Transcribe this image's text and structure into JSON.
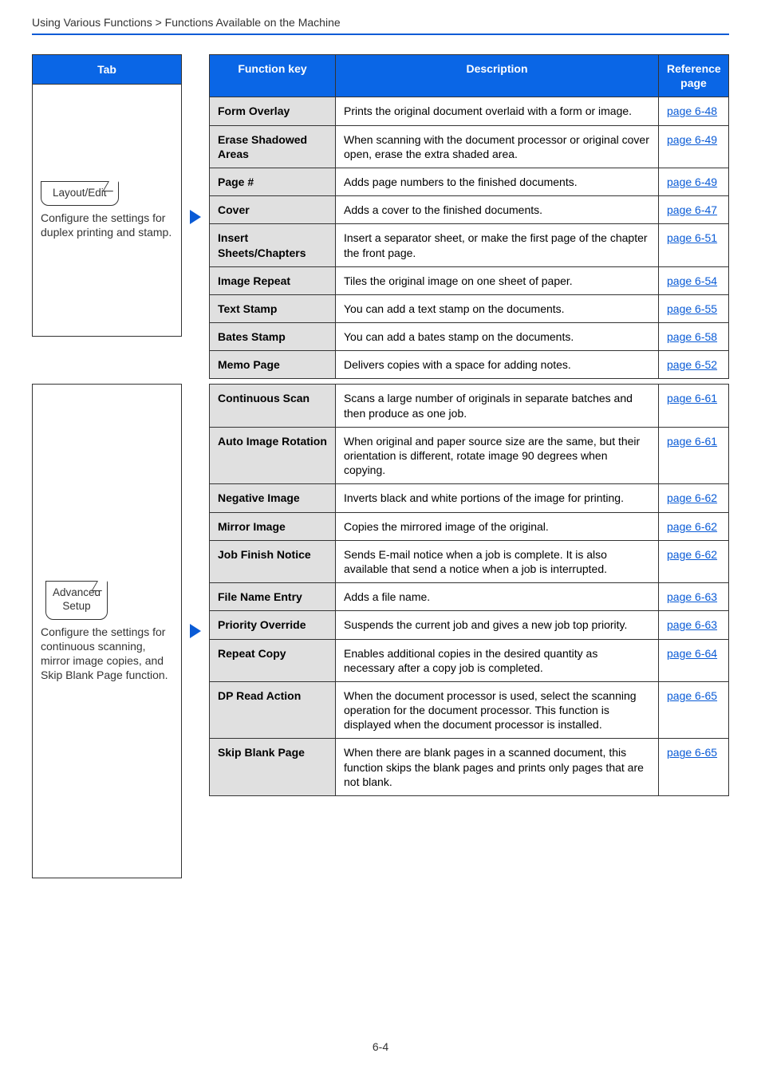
{
  "breadcrumb": "Using Various Functions > Functions Available on the Machine",
  "tab_header": "Tab",
  "headers": {
    "fn": "Function key",
    "desc": "Description",
    "ref": "Reference page"
  },
  "box1": {
    "chip": "Layout/Edit",
    "desc": "Configure the settings for duplex printing and stamp.",
    "rows": [
      {
        "fn": "Form Overlay",
        "desc": "Prints the original document overlaid with a form or image.",
        "ref": "page 6-48"
      },
      {
        "fn": "Erase Shadowed Areas",
        "desc": "When scanning with the document processor or original cover open, erase the extra shaded area.",
        "ref": "page 6-49"
      },
      {
        "fn": "Page #",
        "desc": "Adds page numbers to the finished documents.",
        "ref": "page 6-49"
      },
      {
        "fn": "Cover",
        "desc": "Adds a cover to the finished documents.",
        "ref": "page 6-47"
      },
      {
        "fn": "Insert Sheets/Chapters",
        "desc": "Insert a separator sheet, or make the first page of the chapter the front page.",
        "ref": "page 6-51"
      },
      {
        "fn": "Image Repeat",
        "desc": "Tiles the original image on one sheet of paper.",
        "ref": "page 6-54"
      },
      {
        "fn": "Text Stamp",
        "desc": "You can add a text stamp on the documents.",
        "ref": "page 6-55"
      },
      {
        "fn": "Bates Stamp",
        "desc": "You can add a bates stamp on the documents.",
        "ref": "page 6-58"
      },
      {
        "fn": "Memo Page",
        "desc": "Delivers copies with a space for adding notes.",
        "ref": "page 6-52"
      }
    ]
  },
  "box2": {
    "chip_l1": "Advanced",
    "chip_l2": "Setup",
    "desc": "Configure the settings for continuous scanning, mirror image copies, and Skip Blank Page function.",
    "rows": [
      {
        "fn": "Continuous Scan",
        "desc": "Scans a large number of originals in separate batches and then produce as one job.",
        "ref": "page 6-61"
      },
      {
        "fn": "Auto Image Rotation",
        "desc": "When original and paper source size are the same, but their orientation is different, rotate image 90 degrees when copying.",
        "ref": "page 6-61"
      },
      {
        "fn": "Negative Image",
        "desc": "Inverts black and white portions of the image for printing.",
        "ref": "page 6-62"
      },
      {
        "fn": "Mirror Image",
        "desc": "Copies the mirrored image of the original.",
        "ref": "page 6-62"
      },
      {
        "fn": "Job Finish Notice",
        "desc": "Sends E-mail notice when a job is complete. It is also available that send a notice when a job is interrupted.",
        "ref": "page 6-62"
      },
      {
        "fn": "File Name Entry",
        "desc": "Adds a file name.",
        "ref": "page 6-63"
      },
      {
        "fn": "Priority Override",
        "desc": "Suspends the current job and gives a new job top priority.",
        "ref": "page 6-63"
      },
      {
        "fn": "Repeat Copy",
        "desc": "Enables additional copies in the desired quantity as necessary after a copy job is completed.",
        "ref": "page 6-64"
      },
      {
        "fn": "DP Read Action",
        "desc": "When the document processor is used, select the scanning operation for the document processor. This function is displayed when the document processor is installed.",
        "ref": "page 6-65"
      },
      {
        "fn": "Skip Blank Page",
        "desc": "When there are blank pages in a scanned document, this function skips the blank pages and prints only pages that are not blank.",
        "ref": "page 6-65"
      }
    ]
  },
  "page_number": "6-4"
}
